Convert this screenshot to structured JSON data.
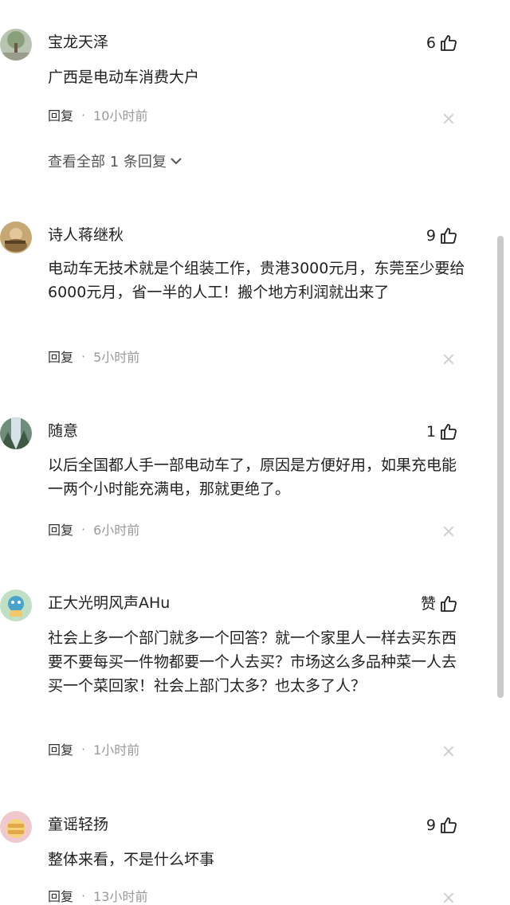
{
  "reply_label": "回复",
  "dot": "·",
  "comments": [
    {
      "username": "宝龙天泽",
      "likes": "6",
      "text": "广西是电动车消费大户",
      "time": "10小时前",
      "view_all": "查看全部 1 条回复"
    },
    {
      "username": "诗人蒋继秋",
      "likes": "9",
      "text": "电动车无技术就是个组装工作，贵港3000元月，东莞至少要给6000元月，省一半的人工！搬个地方利润就出来了",
      "time": "5小时前"
    },
    {
      "username": "随意",
      "likes": "1",
      "text": "以后全国都人手一部电动车了，原因是方便好用，如果充电能一两个小时能充满电，那就更绝了。",
      "time": "6小时前"
    },
    {
      "username": "正大光明风声AHu",
      "likes": "赞",
      "text": "社会上多一个部门就多一个回答？就一个家里人一样去买东西要不要每买一件物都要一个人去买？市场这么多品种菜一人去买一个菜回家！社会上部门太多？也太多了人？",
      "time": "1小时前"
    },
    {
      "username": "童谣轻扬",
      "likes": "9",
      "text": "整体来看，不是什么坏事",
      "time": "13小时前"
    }
  ],
  "colors": {
    "text": "#222222",
    "muted": "#999999",
    "close": "#cfcfcf",
    "scrollbar": "#c9c9c9"
  },
  "icons": [
    "thumbs-up-icon",
    "chevron-down-icon",
    "close-icon"
  ]
}
